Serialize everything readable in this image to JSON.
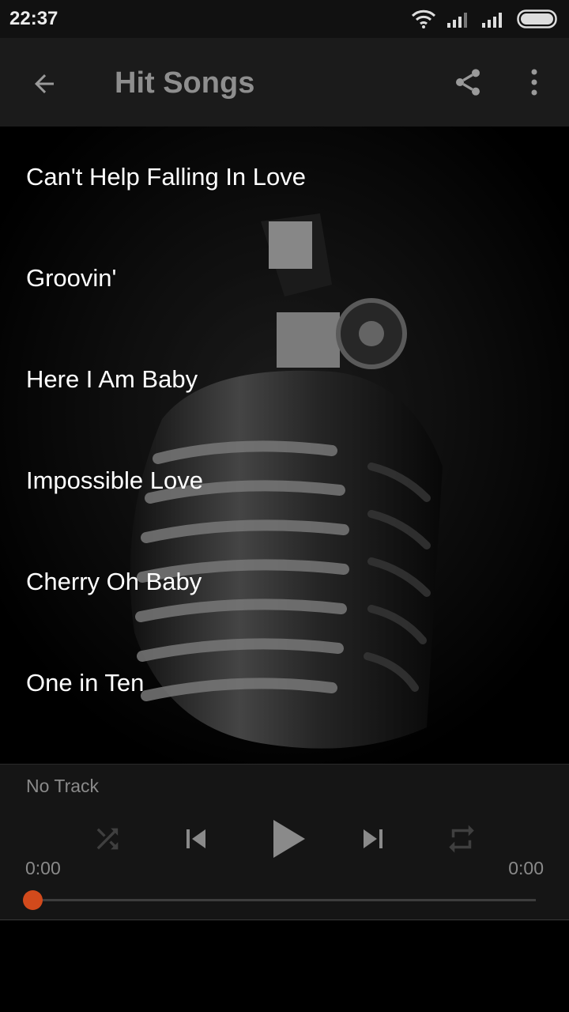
{
  "status_bar": {
    "time": "22:37",
    "battery_icon": "battery-full-icon",
    "wifi_icon": "wifi-icon",
    "signal_icon": "cellular-signal-icon"
  },
  "app_bar": {
    "title": "Hit Songs",
    "back_icon": "arrow-back-icon",
    "share_icon": "share-icon",
    "more_icon": "more-vertical-icon"
  },
  "songs": [
    {
      "title": "Can't Help Falling In Love"
    },
    {
      "title": "Groovin'"
    },
    {
      "title": "Here I Am Baby"
    },
    {
      "title": "Impossible Love"
    },
    {
      "title": "Cherry Oh Baby"
    },
    {
      "title": "One in Ten"
    }
  ],
  "player": {
    "track": "No Track",
    "elapsed": "0:00",
    "duration": "0:00",
    "progress": 0,
    "controls": [
      "shuffle-icon",
      "skip-previous-icon",
      "play-icon",
      "skip-next-icon",
      "repeat-icon"
    ]
  },
  "colors": {
    "accent": "#d24a1c",
    "app_bar_bg": "#1b1b1b",
    "player_bg": "#151515",
    "title": "#8e8e8e"
  }
}
